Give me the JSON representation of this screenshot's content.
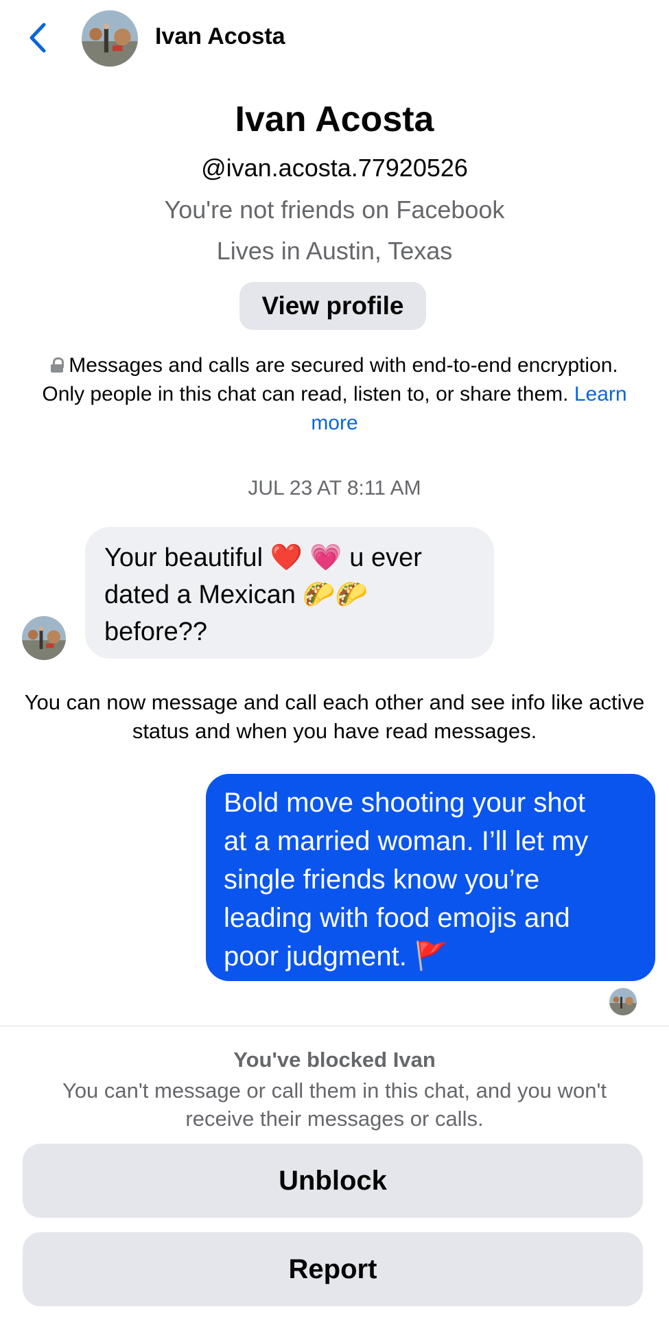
{
  "header": {
    "name": "Ivan Acosta",
    "back_icon": "chevron-left-icon"
  },
  "profile": {
    "name": "Ivan Acosta",
    "handle": "@ivan.acosta.77920526",
    "friend_status": "You're not friends on Facebook",
    "location": "Lives in Austin, Texas",
    "view_profile_label": "View profile"
  },
  "encryption_notice": {
    "text": "Messages and calls are secured with end-to-end encryption. Only people in this chat can read, listen to, or share them.",
    "learn_more": "Learn more"
  },
  "timestamp": "JUL 23 AT 8:11 AM",
  "messages": [
    {
      "direction": "incoming",
      "lines": [
        "Your beautiful ❤️ 💗 u ever",
        "dated a Mexican 🌮🌮",
        "before??"
      ]
    },
    {
      "direction": "outgoing",
      "lines": [
        "Bold move shooting your shot",
        "at a married woman. I’ll let my",
        "single friends know you’re",
        "leading with food emojis and",
        "poor judgment. 🚩"
      ]
    }
  ],
  "system_message": "You can now message and call each other and see info like active status and when you have read messages.",
  "blocked": {
    "title": "You've blocked Ivan",
    "description": "You can't message or call them in this chat, and you won't receive their messages or calls."
  },
  "actions": {
    "unblock": "Unblock",
    "report": "Report"
  },
  "colors": {
    "accent_blue": "#0a55ee",
    "link_blue": "#0a66d8",
    "button_gray": "#e4e6eb",
    "incoming_bubble": "#eff0f3",
    "secondary_text": "#65676b"
  }
}
